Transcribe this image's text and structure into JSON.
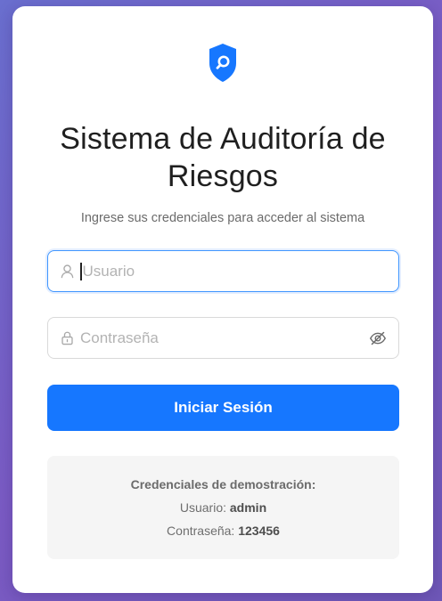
{
  "app": {
    "title": "Sistema de Auditoría de Riesgos",
    "subtitle": "Ingrese sus credenciales para acceder al sistema"
  },
  "form": {
    "username": {
      "placeholder": "Usuario",
      "value": "",
      "icon": "user-icon"
    },
    "password": {
      "placeholder": "Contraseña",
      "value": "",
      "icon": "lock-icon",
      "toggle_icon": "eye-slash-icon"
    },
    "submit_label": "Iniciar Sesión"
  },
  "demo": {
    "heading": "Credenciales de demostración:",
    "user_label": "Usuario:",
    "user_value": "admin",
    "pass_label": "Contraseña:",
    "pass_value": "123456"
  },
  "colors": {
    "primary": "#1677ff",
    "focus_border": "#4096ff",
    "background_gradient_start": "#6a6fcf",
    "background_gradient_end": "#6f58b8",
    "card": "#ffffff",
    "demo_box": "#f5f5f5"
  }
}
